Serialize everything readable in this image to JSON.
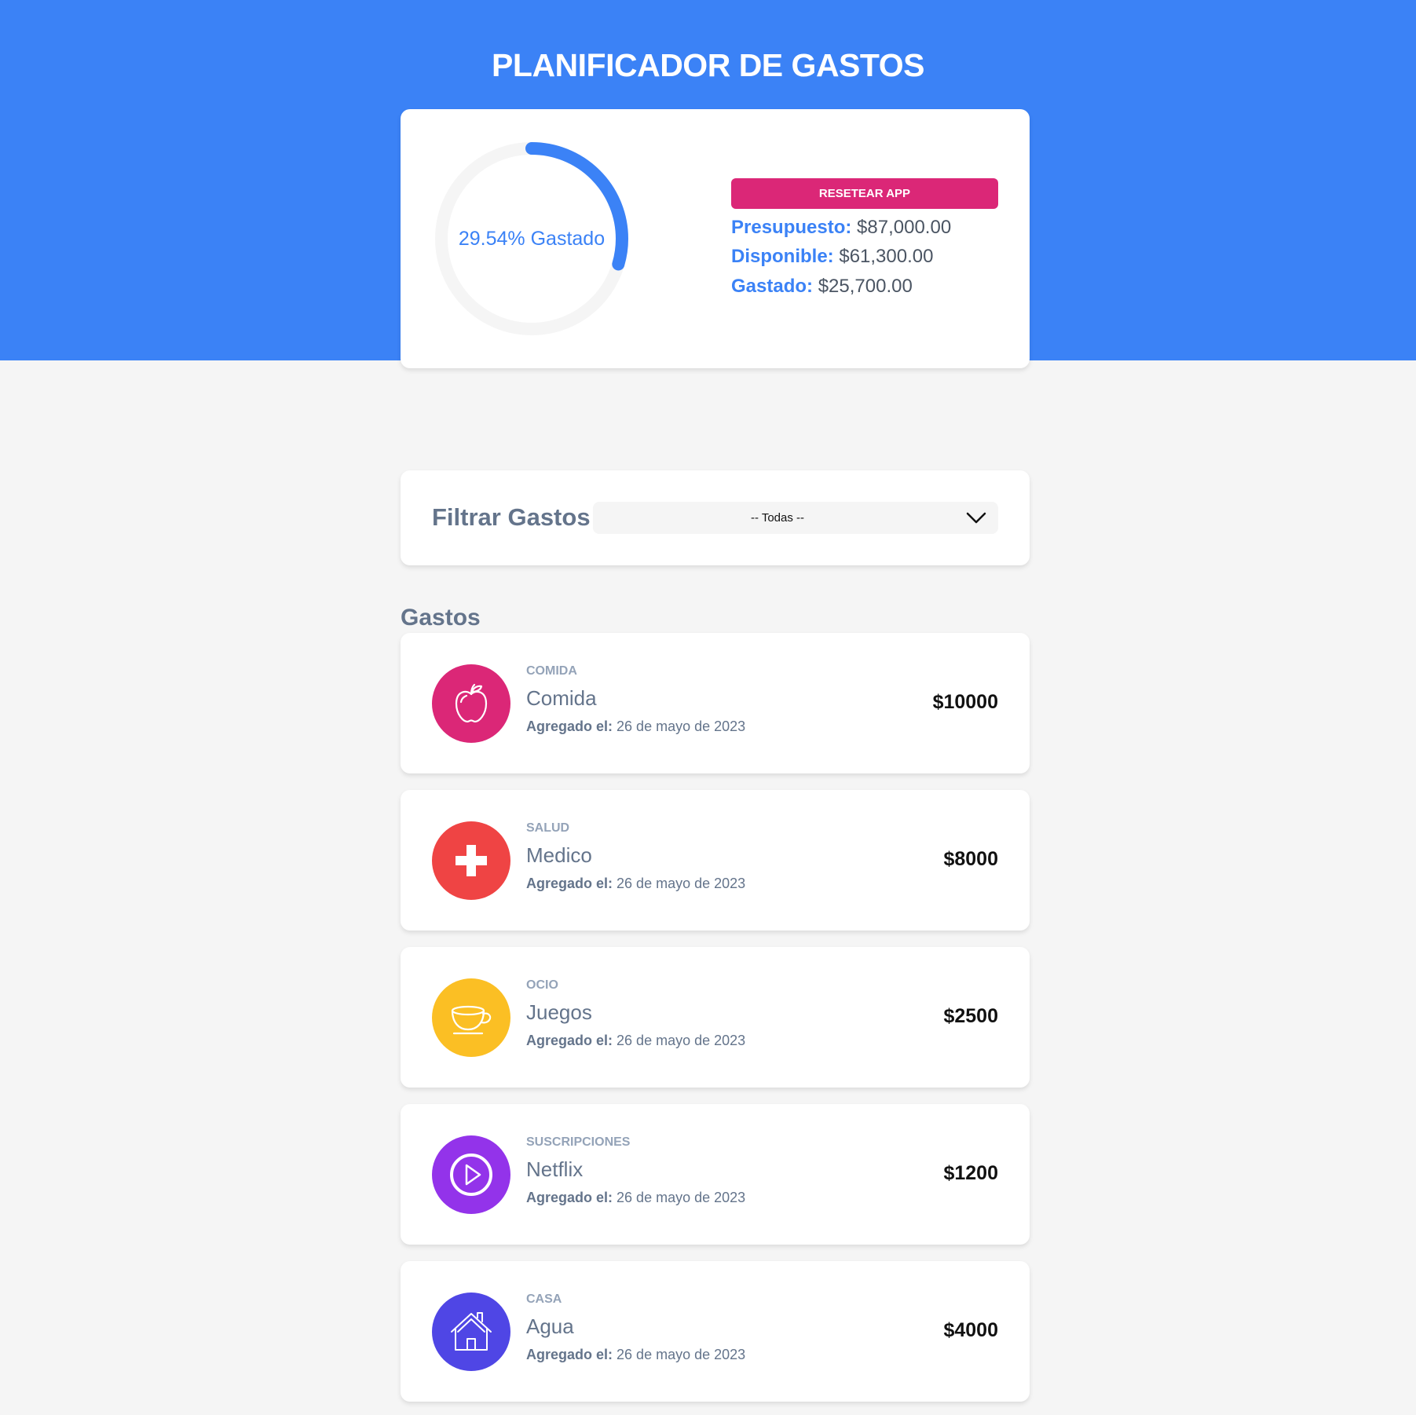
{
  "header": {
    "title": "PLANIFICADOR DE GASTOS"
  },
  "budget": {
    "percent_spent": 29.54,
    "progress_label": "29.54% Gastado",
    "reset_label": "RESETEAR APP",
    "presupuesto_label": "Presupuesto:",
    "presupuesto_value": "$87,000.00",
    "disponible_label": "Disponible:",
    "disponible_value": "$61,300.00",
    "gastado_label": "Gastado:",
    "gastado_value": "$25,700.00"
  },
  "filter": {
    "label": "Filtrar Gastos",
    "selected": "-- Todas --"
  },
  "expenses": {
    "title": "Gastos",
    "date_label": "Agregado el:",
    "items": [
      {
        "category": "COMIDA",
        "name": "Comida",
        "date": "26 de mayo de 2023",
        "amount": "$10000",
        "icon": "apple-icon",
        "color": "#db2777"
      },
      {
        "category": "SALUD",
        "name": "Medico",
        "date": "26 de mayo de 2023",
        "amount": "$8000",
        "icon": "medical-cross-icon",
        "color": "#ef4444"
      },
      {
        "category": "OCIO",
        "name": "Juegos",
        "date": "26 de mayo de 2023",
        "amount": "$2500",
        "icon": "cup-icon",
        "color": "#fbbf24"
      },
      {
        "category": "SUSCRIPCIONES",
        "name": "Netflix",
        "date": "26 de mayo de 2023",
        "amount": "$1200",
        "icon": "play-icon",
        "color": "#9333ea"
      },
      {
        "category": "CASA",
        "name": "Agua",
        "date": "26 de mayo de 2023",
        "amount": "$4000",
        "icon": "house-icon",
        "color": "#4f46e5"
      }
    ]
  },
  "colors": {
    "primary": "#3b82f6",
    "accent": "#db2777",
    "track": "#f5f5f5"
  }
}
